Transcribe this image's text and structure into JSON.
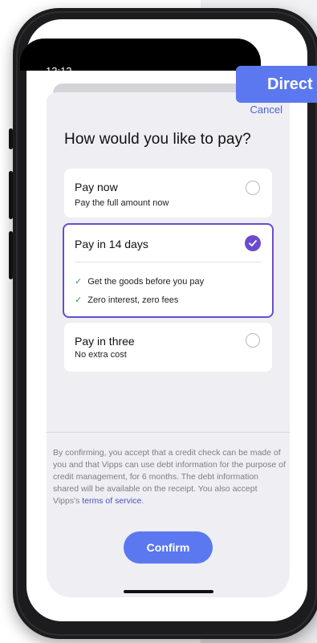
{
  "status_bar": {
    "time": "13:12"
  },
  "banner": {
    "text": "Direct"
  },
  "sheet": {
    "cancel_label": "Cancel",
    "title": "How would you like to pay?"
  },
  "options": [
    {
      "title": "Pay now",
      "subtitle": "Pay the full amount now",
      "selected": false
    },
    {
      "title": "Pay in 14 days",
      "selected": true,
      "benefits": [
        "Get the goods before you pay",
        "Zero interest, zero fees"
      ]
    },
    {
      "title": "Pay in three",
      "subtitle": "No extra cost",
      "selected": false
    }
  ],
  "legal": {
    "text": "By confirming, you accept that a credit check can be made of you and that Vipps can use debt information for the purpose of credit management, for 6 months. The debt information shared will be available on the receipt. You also accept Vipps's ",
    "link_text": "terms of service",
    "end": "."
  },
  "confirm_label": "Confirm",
  "colors": {
    "accent": "#5b78f0",
    "selected_border": "#6a4bcf",
    "check_green": "#2f9a55",
    "sheet_bg": "#eeeef3"
  }
}
